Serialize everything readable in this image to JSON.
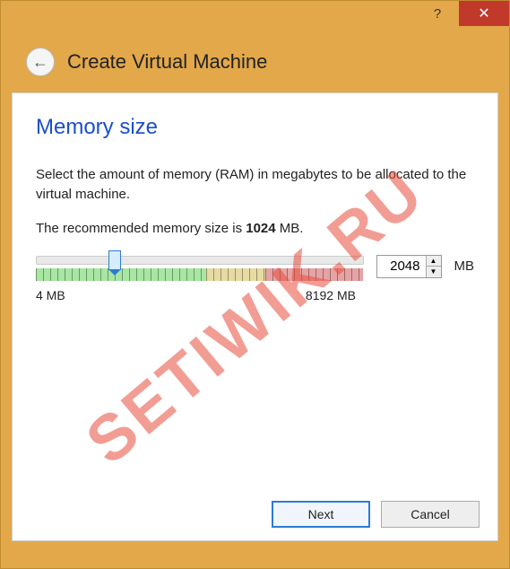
{
  "titlebar": {
    "help_glyph": "?",
    "close_glyph": "✕"
  },
  "header": {
    "back_glyph": "←",
    "title": "Create Virtual Machine"
  },
  "section": {
    "title": "Memory size",
    "description": "Select the amount of memory (RAM) in megabytes to be allocated to the virtual machine.",
    "recommend_prefix": "The recommended memory size is ",
    "recommend_value": "1024",
    "recommend_suffix": " MB."
  },
  "slider": {
    "min_label": "4 MB",
    "max_label": "8192 MB",
    "value": "2048",
    "unit": "MB",
    "thumb_percent": 24
  },
  "footer": {
    "next_label": "Next",
    "cancel_label": "Cancel"
  },
  "watermark": "SETIWIK.RU"
}
